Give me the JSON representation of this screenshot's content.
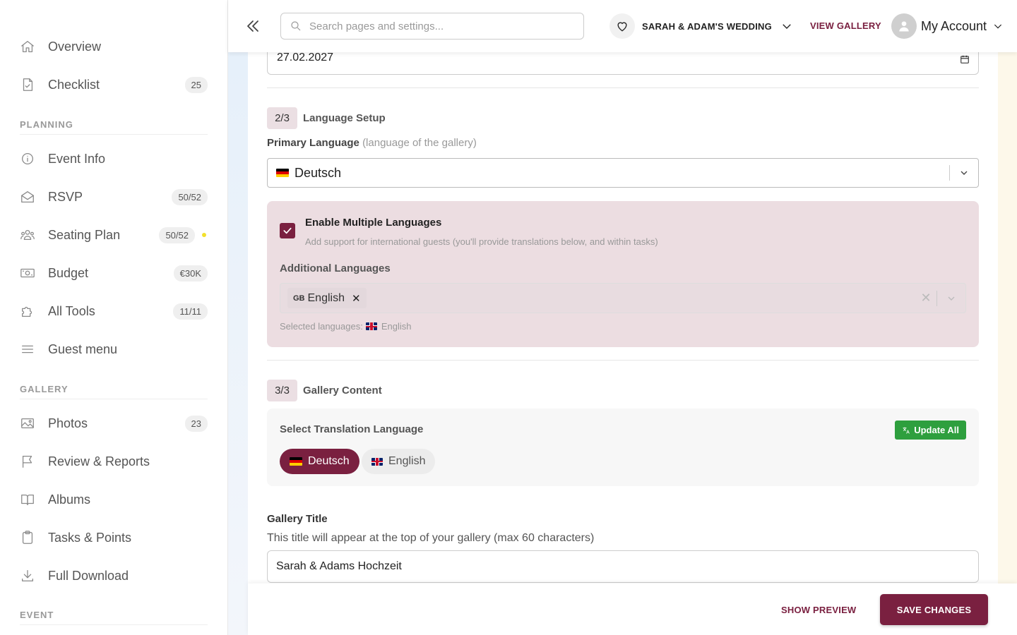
{
  "sidebar": {
    "items": [
      {
        "label": "Overview",
        "badge": ""
      },
      {
        "label": "Checklist",
        "badge": "25"
      },
      {
        "label": "Event Info",
        "badge": ""
      },
      {
        "label": "RSVP",
        "badge": "50/52"
      },
      {
        "label": "Seating Plan",
        "badge": "50/52"
      },
      {
        "label": "Budget",
        "badge": "€30K"
      },
      {
        "label": "All Tools",
        "badge": "11/11"
      },
      {
        "label": "Guest menu",
        "badge": ""
      },
      {
        "label": "Photos",
        "badge": "23"
      },
      {
        "label": "Review & Reports",
        "badge": ""
      },
      {
        "label": "Albums",
        "badge": ""
      },
      {
        "label": "Tasks & Points",
        "badge": ""
      },
      {
        "label": "Full Download",
        "badge": ""
      }
    ],
    "sections": {
      "planning": "PLANNING",
      "gallery": "GALLERY",
      "event": "EVENT"
    }
  },
  "topbar": {
    "search_placeholder": "Search pages and settings...",
    "wedding_name": "SARAH & ADAM'S WEDDING",
    "view_gallery": "VIEW GALLERY",
    "account": "My Account"
  },
  "main": {
    "date_value": "27.02.2027",
    "step2": {
      "num": "2/3",
      "title": "Language Setup"
    },
    "primary_language": {
      "label": "Primary Language",
      "hint": "(language of the gallery)",
      "value": "Deutsch"
    },
    "multi": {
      "enable_title": "Enable Multiple Languages",
      "enable_desc": "Add support for international guests (you'll provide translations below, and within tasks)",
      "additional_label": "Additional Languages",
      "chip_code": "GB",
      "chip_name": "English",
      "selected_prefix": "Selected languages:",
      "selected_value": "English"
    },
    "step3": {
      "num": "3/3",
      "title": "Gallery Content"
    },
    "translation": {
      "label": "Select Translation Language",
      "update_all": "Update All",
      "langs": [
        "Deutsch",
        "English"
      ]
    },
    "gallery_title": {
      "label": "Gallery Title",
      "help": "This title will appear at the top of your gallery (max 60 characters)",
      "value": "Sarah & Adams Hochzeit"
    }
  },
  "footer": {
    "show_preview": "SHOW PREVIEW",
    "save": "SAVE CHANGES"
  },
  "colors": {
    "brand": "#7a2040",
    "success": "#2e9f3e",
    "accent_dot": "#f2e02b"
  }
}
